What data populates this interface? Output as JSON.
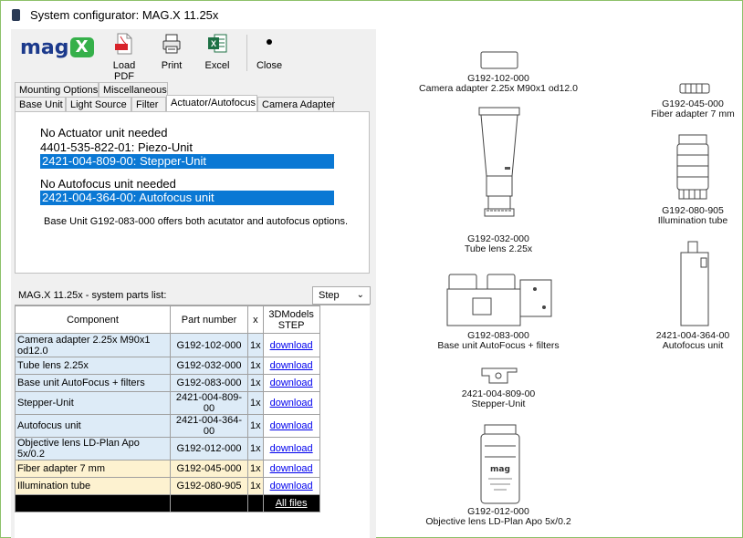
{
  "window": {
    "title": "System configurator: MAG.X 11.25x"
  },
  "toolbar": {
    "logo_text": "mag",
    "logo_x": "X",
    "load_pdf": "Load PDF",
    "print": "Print",
    "excel": "Excel",
    "close": "Close"
  },
  "tabs": {
    "row1": [
      "Mounting Options",
      "Miscellaneous"
    ],
    "row2": [
      "Base Unit",
      "Light Source",
      "Filter",
      "Actuator/Autofocus",
      "Camera Adapter"
    ]
  },
  "actuator": {
    "options": [
      "No Actuator unit needed",
      "4401-535-822-01: Piezo-Unit",
      "2421-004-809-00: Stepper-Unit"
    ],
    "autofocus": [
      "No Autofocus unit needed",
      "2421-004-364-00: Autofocus unit"
    ],
    "note": "Base Unit G192-083-000 offers both acutator and autofocus options."
  },
  "parts": {
    "header": "MAG.X 11.25x - system parts list:",
    "format": "Step",
    "columns": [
      "Component",
      "Part number",
      "x",
      "3DModels STEP"
    ],
    "rows": [
      {
        "component": "Camera adapter 2.25x M90x1 od12.0",
        "part": "G192-102-000",
        "qty": "1x",
        "link": "download"
      },
      {
        "component": "Tube lens 2.25x",
        "part": "G192-032-000",
        "qty": "1x",
        "link": "download"
      },
      {
        "component": "Base unit AutoFocus + filters",
        "part": "G192-083-000",
        "qty": "1x",
        "link": "download"
      },
      {
        "component": "Stepper-Unit",
        "part": "2421-004-809-00",
        "qty": "1x",
        "link": "download"
      },
      {
        "component": "Autofocus unit",
        "part": "2421-004-364-00",
        "qty": "1x",
        "link": "download"
      },
      {
        "component": "Objective lens LD-Plan Apo 5x/0.2",
        "part": "G192-012-000",
        "qty": "1x",
        "link": "download"
      },
      {
        "component": "Fiber adapter 7 mm",
        "part": "G192-045-000",
        "qty": "1x",
        "link": "download"
      },
      {
        "component": "Illumination tube",
        "part": "G192-080-905",
        "qty": "1x",
        "link": "download"
      }
    ],
    "all_files": "All files"
  },
  "diagram": {
    "camera_adapter": {
      "pn": "G192-102-000",
      "name": "Camera adapter 2.25x M90x1 od12.0"
    },
    "tube_lens": {
      "pn": "G192-032-000",
      "name": "Tube lens 2.25x"
    },
    "base_unit": {
      "pn": "G192-083-000",
      "name": "Base unit AutoFocus + filters"
    },
    "stepper": {
      "pn": "2421-004-809-00",
      "name": "Stepper-Unit"
    },
    "objective": {
      "pn": "G192-012-000",
      "name": "Objective lens LD-Plan Apo 5x/0.2",
      "label_mag": "mag"
    },
    "fiber": {
      "pn": "G192-045-000",
      "name": "Fiber adapter 7 mm"
    },
    "illumination": {
      "pn": "G192-080-905",
      "name": "Illumination tube"
    },
    "autofocus": {
      "pn": "2421-004-364-00",
      "name": "Autofocus unit"
    }
  },
  "colors": {
    "selection": "#0a78d4",
    "row_blue": "#ddebf7",
    "row_yellow": "#fdf2d0",
    "logo_blue": "#1c3a8c",
    "logo_green": "#35b04a"
  }
}
